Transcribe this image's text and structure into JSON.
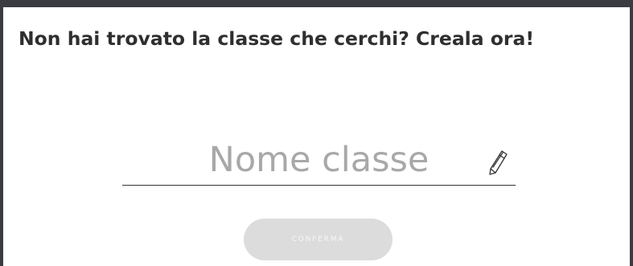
{
  "dialog": {
    "title": "Non hai trovato la classe che cerchi? Creala ora!",
    "class_name_field": {
      "placeholder": "Nome classe",
      "value": ""
    },
    "edit_icon": "pencil-icon",
    "confirm_label": "CONFERMA"
  },
  "colors": {
    "backdrop": "#3a3c42",
    "panel": "#ffffff",
    "title_text": "#2f2f2f",
    "placeholder_text": "#a8a8a8",
    "underline": "#333333",
    "button_disabled_bg": "#dcdcdc",
    "button_text": "#f7f7f7"
  }
}
